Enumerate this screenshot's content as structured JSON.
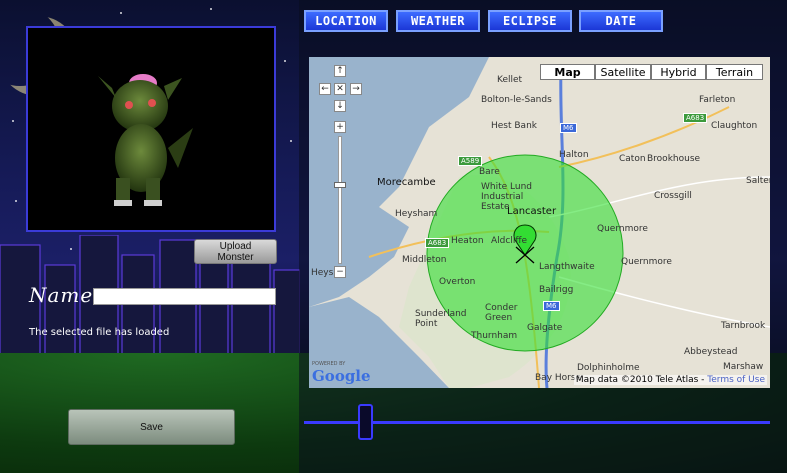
{
  "nav": {
    "tabs": [
      {
        "label": "LOCATION"
      },
      {
        "label": "WEATHER"
      },
      {
        "label": "ECLIPSE"
      },
      {
        "label": "DATE"
      }
    ]
  },
  "monster": {
    "upload_label": "Upload Monster",
    "name_label": "Name:",
    "name_value": "",
    "status": "The selected file has loaded",
    "save_label": "Save"
  },
  "map": {
    "map_types": [
      "Map",
      "Satellite",
      "Hybrid",
      "Terrain"
    ],
    "selected_type": "Map",
    "place_names": {
      "kellet": "Kellet",
      "farleton": "Farleton",
      "bolton": "Bolton-le-Sands",
      "claughton": "Claughton",
      "hestbank": "Hest Bank",
      "halton": "Halton",
      "caton": "Caton",
      "brookhouse": "Brookhouse",
      "morecambe": "Morecambe",
      "bare": "Bare",
      "whitelund": "White Lund Industrial Estate",
      "salter": "Salter",
      "crossgill": "Crossgill",
      "heysham": "Heysham",
      "lancaster": "Lancaster",
      "quernmore1": "Quernmore",
      "quernmore2": "Quernmore",
      "heaton": "Heaton",
      "aldcliffe": "Aldcliffe",
      "middleton": "Middleton",
      "langthwaite": "Langthwaite",
      "overton": "Overton",
      "bailrigg": "Bailrigg",
      "sunderland": "Sunderland Point",
      "conder": "Conder Green",
      "galgate": "Galgate",
      "tarnbrook": "Tarnbrook",
      "thurnham": "Thurnham",
      "abbeystead": "Abbeystead",
      "dolphinholme": "Dolphinholme",
      "marshaw": "Marshaw",
      "bayhorse": "Bay Horse",
      "heysham_moss": "Heysha"
    },
    "roads": {
      "a683a": "A683",
      "a683b": "A683",
      "a589": "A589",
      "m6a": "M6",
      "m6b": "M6"
    },
    "zoom_level_fraction": 0.62,
    "credit_text": "Map data ©2010 Tele Atlas -",
    "terms_link": "Terms of Use",
    "logo_powered": "POWERED BY",
    "logo_text": "Google",
    "marker_icon": "map-pin-icon",
    "radius_color": "#33e033"
  },
  "timeline": {
    "position_fraction": 0.12
  },
  "colors": {
    "tab_bg": "#1b37d6",
    "tab_border": "#7aa0ff",
    "slider": "#3a3aff"
  }
}
